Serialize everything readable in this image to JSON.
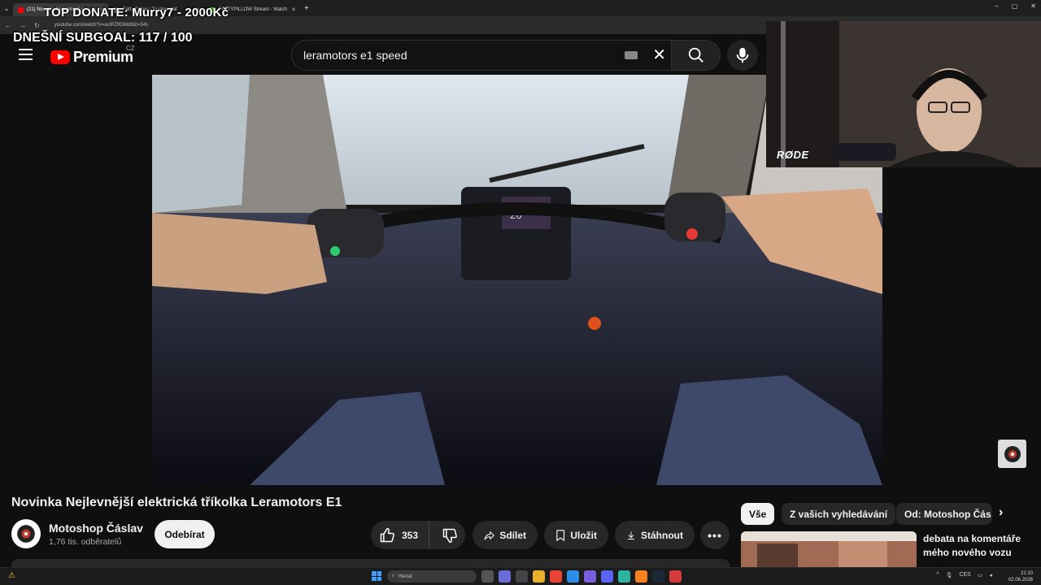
{
  "browser": {
    "tabs": [
      {
        "title": "(21) Novinka Nejlevnější e",
        "active": true,
        "color": "#ff0000"
      },
      {
        "title": "Fatty Pillow | Trucker Hat",
        "active": false,
        "color": "#888888"
      },
      {
        "title": "FATTYPILLOW Stream - Watch",
        "active": false,
        "color": "#53fc18"
      }
    ],
    "url": "youtube.com/watch?v=axtPZIfGMd8&t=54s",
    "new_tab": "+"
  },
  "overlay": {
    "top_donate": "TOP DONATE: Murry7 - 2000Kč",
    "subgoal": "DNEŠNÍ SUBGOAL: 117 / 100"
  },
  "youtube": {
    "logo_text": "Premium",
    "country_code": "CZ",
    "search_value": "leramotors e1 speed"
  },
  "webcam": {
    "brand": "RØDE"
  },
  "video": {
    "title": "Novinka Nejlevnější elektrická tříkolka Leramotors E1",
    "channel": "Motoshop Čáslav",
    "subscribers": "1,76 tis. odběratelů",
    "subscribe_label": "Odebírat",
    "like_count": "353",
    "share_label": "Sdílet",
    "save_label": "Uložit",
    "download_label": "Stáhnout",
    "speedometer": "26"
  },
  "chips": [
    "Vše",
    "Z vašich vyhledávání",
    "Od: Motoshop Čás"
  ],
  "recommended": {
    "title": "debata na komentáře mého nového vozu"
  },
  "taskbar": {
    "search_placeholder": "Hledat",
    "lang": "CES",
    "time": "21:10",
    "date": "02.06.2026"
  },
  "colors": {
    "accent": "#ff0000",
    "background": "#0f0f0f"
  }
}
